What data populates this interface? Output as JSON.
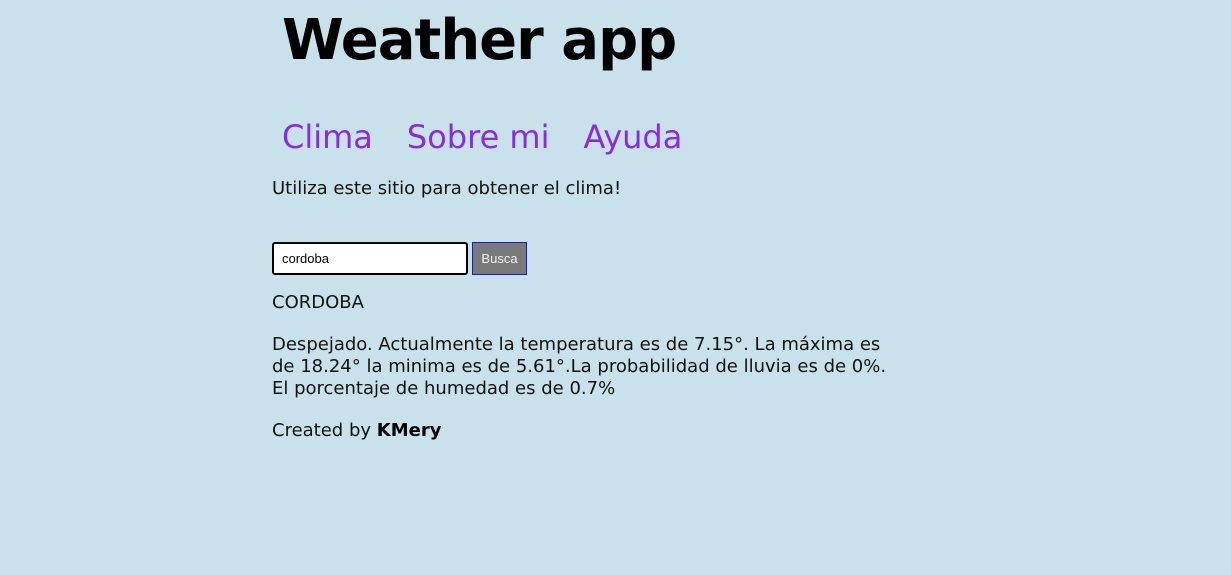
{
  "header": {
    "title": "Weather app"
  },
  "nav": {
    "items": [
      {
        "label": "Clima"
      },
      {
        "label": "Sobre mi"
      },
      {
        "label": "Ayuda"
      }
    ]
  },
  "intro": "Utiliza este sitio para obtener el clima!",
  "search": {
    "value": "cordoba",
    "button_label": "Busca"
  },
  "result": {
    "city": "CORDOBA",
    "description": "Despejado. Actualmente la temperatura es de 7.15°. La máxima es de 18.24° la minima es de 5.61°.La probabilidad de lluvia es de 0%. El porcentaje de humedad es de 0.7%"
  },
  "footer": {
    "prefix": "Created by",
    "author": "KMery"
  },
  "colors": {
    "background": "#c8e1ea",
    "nav_link": "#8a2be2",
    "button_bg": "#7a7a7a",
    "button_border": "#1a1ad0"
  }
}
